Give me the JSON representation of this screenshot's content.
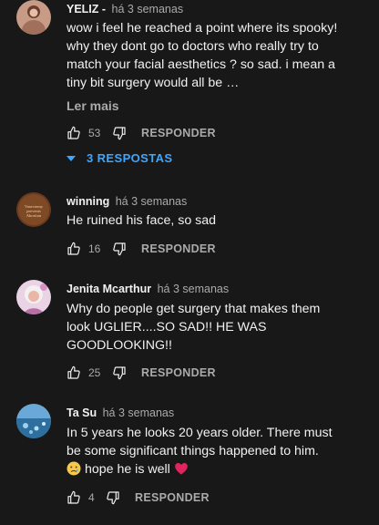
{
  "comments": [
    {
      "author": "YELIZ -",
      "time": "há 3 semanas",
      "text": "wow i feel he reached a point where its spooky! why they dont go to doctors who really try to match your facial aesthetics ? so sad. i mean a tiny bit surgery would all be …",
      "read_more": "Ler mais",
      "likes": "53",
      "reply": "RESPONDER",
      "replies_label": "3 RESPOSTAS"
    },
    {
      "author": "winning",
      "time": "há 3 semanas",
      "avatar_text": [
        "Vasectomy",
        "prevents",
        "Abortion"
      ],
      "text": "He ruined his face, so sad",
      "likes": "16",
      "reply": "RESPONDER"
    },
    {
      "author": "Jenita Mcarthur",
      "time": "há 3 semanas",
      "text": "Why do people get surgery that makes them look UGLIER....SO SAD!! HE WAS GOODLOOKING!!",
      "likes": "25",
      "reply": "RESPONDER"
    },
    {
      "author": "Ta Su",
      "time": "há 3 semanas",
      "text": "In 5 years he looks 20 years older. There must be some significant things happened to him.",
      "text_end": "hope he is well",
      "likes": "4",
      "reply": "RESPONDER"
    }
  ],
  "icons": {
    "like": "thumb-up-icon",
    "dislike": "thumb-down-icon",
    "expand": "caret-down-icon",
    "sad_emoji": "crying-face-emoji",
    "heart_emoji": "red-heart-emoji"
  },
  "colors": {
    "background": "#181818",
    "text": "#f1f1f1",
    "secondary": "#aaaaaa",
    "link": "#3ea6ff"
  }
}
